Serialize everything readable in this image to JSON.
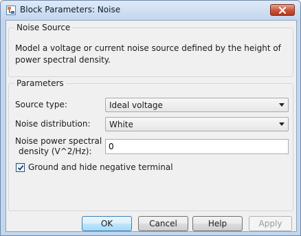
{
  "window": {
    "title": "Block Parameters: Noise",
    "app_icon": "simulink-block-icon",
    "close_icon": "close-icon"
  },
  "noise_source": {
    "legend": "Noise Source",
    "description": "Model a voltage or current noise source defined by the height of power spectral density."
  },
  "parameters": {
    "legend": "Parameters",
    "source_type": {
      "label": "Source type:",
      "value": "Ideal voltage"
    },
    "noise_distribution": {
      "label": "Noise distribution:",
      "value": "White"
    },
    "noise_psd": {
      "label_line1": "Noise power spectral",
      "label_line2": "density (V^2/Hz):",
      "value": "0"
    },
    "ground_checkbox": {
      "label": "Ground and hide negative terminal",
      "checked": true
    }
  },
  "buttons": {
    "ok": "OK",
    "cancel": "Cancel",
    "help": "Help",
    "apply": "Apply"
  },
  "colors": {
    "title_bar": "#c3d6ee",
    "close_button": "#c95a3f",
    "dialog_body": "#f0f0f0",
    "default_button_border": "#3c7fb1"
  }
}
